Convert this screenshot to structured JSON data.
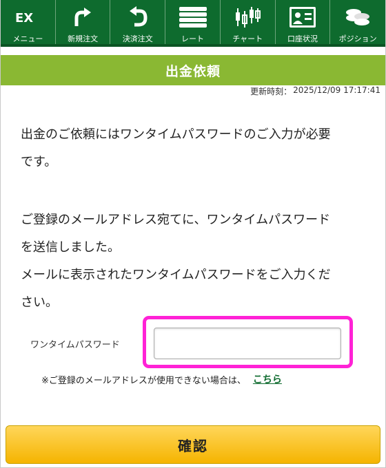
{
  "nav": {
    "items": [
      {
        "icon": "ex-logo-icon",
        "label": "メニュー"
      },
      {
        "icon": "new-order-arrow-icon",
        "label": "新規注文"
      },
      {
        "icon": "settle-order-arrow-icon",
        "label": "決済注文"
      },
      {
        "icon": "rate-list-icon",
        "label": "レート"
      },
      {
        "icon": "candlestick-chart-icon",
        "label": "チャート"
      },
      {
        "icon": "account-card-icon",
        "label": "口座状況"
      },
      {
        "icon": "coins-position-icon",
        "label": "ポジション"
      }
    ]
  },
  "page": {
    "title": "出金依頼",
    "updated_label": "更新時刻：",
    "updated_time": "2025/12/09 17:17:41"
  },
  "content": {
    "para1_line1": "出金のご依頼にはワンタイムパスワードのご入力が必要",
    "para1_line2": "です。",
    "para2_line1": "ご登録のメールアドレス宛てに、ワンタイムパスワード",
    "para2_line2": "を送信しました。",
    "para2_line3": "メールに表示されたワンタイムパスワードをご入力くだ",
    "para2_line4": "さい。"
  },
  "form": {
    "otp_label": "ワンタイムパスワード",
    "otp_value": "",
    "otp_placeholder": ""
  },
  "note": {
    "text": "※ご登録のメールアドレスが使用できない場合は、",
    "link": "こちら"
  },
  "confirm_label": "確認",
  "colors": {
    "nav_bg": "#0e6b2e",
    "title_bg": "#8ab833",
    "highlight": "#ff22d6",
    "confirm_bg": "#f5b400"
  }
}
